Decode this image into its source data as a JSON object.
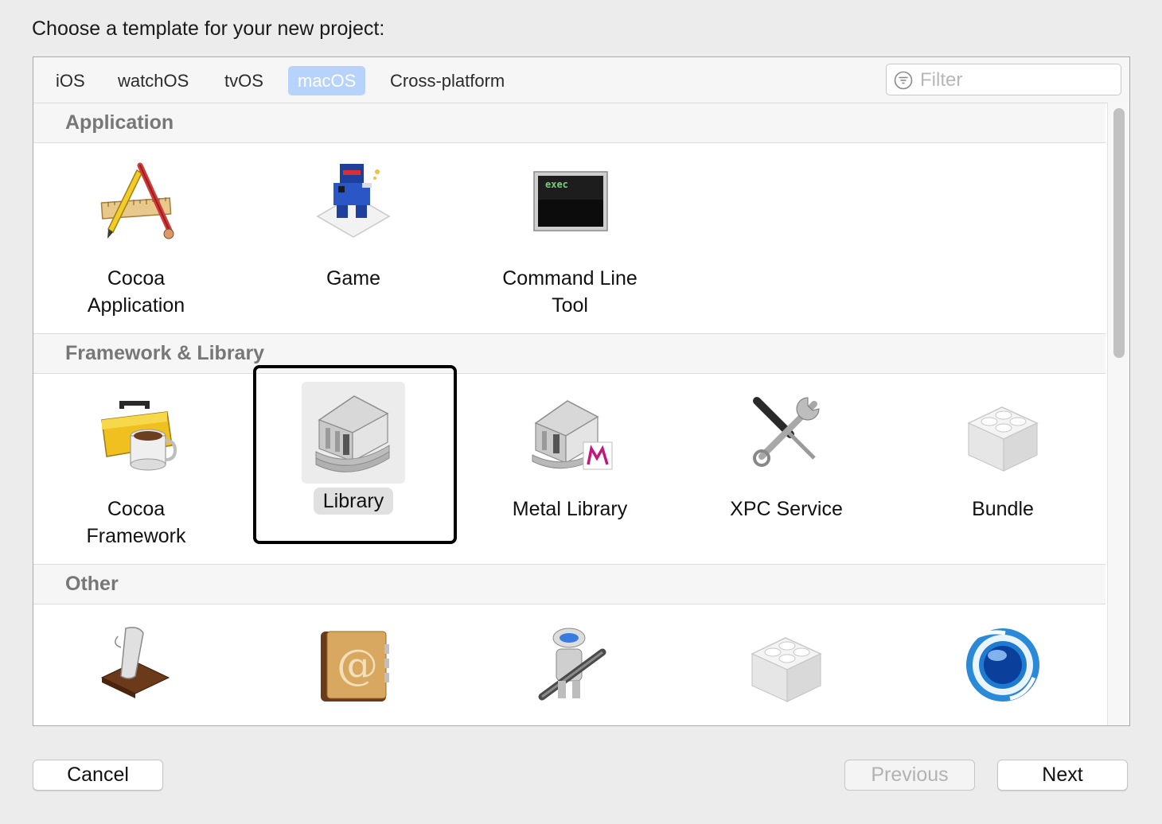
{
  "prompt": "Choose a template for your new project:",
  "tabs": [
    {
      "label": "iOS"
    },
    {
      "label": "watchOS"
    },
    {
      "label": "tvOS"
    },
    {
      "label": "macOS",
      "selected": true
    },
    {
      "label": "Cross-platform"
    }
  ],
  "filter": {
    "placeholder": "Filter",
    "value": ""
  },
  "sections": {
    "application": {
      "title": "Application",
      "items": [
        {
          "label": "Cocoa\nApplication",
          "icon": "pencil-ruler-icon"
        },
        {
          "label": "Game",
          "icon": "ninja-game-icon"
        },
        {
          "label": "Command Line\nTool",
          "icon": "terminal-exec-icon",
          "icon_text": "exec"
        }
      ]
    },
    "framework": {
      "title": "Framework & Library",
      "items": [
        {
          "label": "Cocoa\nFramework",
          "icon": "toolbox-icon"
        },
        {
          "label": "Library",
          "icon": "library-building-icon",
          "selected": true
        },
        {
          "label": "Metal Library",
          "icon": "metal-library-icon"
        },
        {
          "label": "XPC Service",
          "icon": "screwdriver-wrench-icon"
        },
        {
          "label": "Bundle",
          "icon": "lego-brick-icon"
        }
      ]
    },
    "other": {
      "title": "Other",
      "items": [
        {
          "icon": "applescript-scroll-icon"
        },
        {
          "icon": "address-book-icon"
        },
        {
          "icon": "automator-robot-icon"
        },
        {
          "icon": "plugin-brick-icon"
        },
        {
          "icon": "blue-orb-icon"
        }
      ]
    }
  },
  "buttons": {
    "cancel": "Cancel",
    "previous": "Previous",
    "next": "Next"
  },
  "colors": {
    "selected_tab": "#b7d3fb",
    "focus_ring": "#000000"
  }
}
